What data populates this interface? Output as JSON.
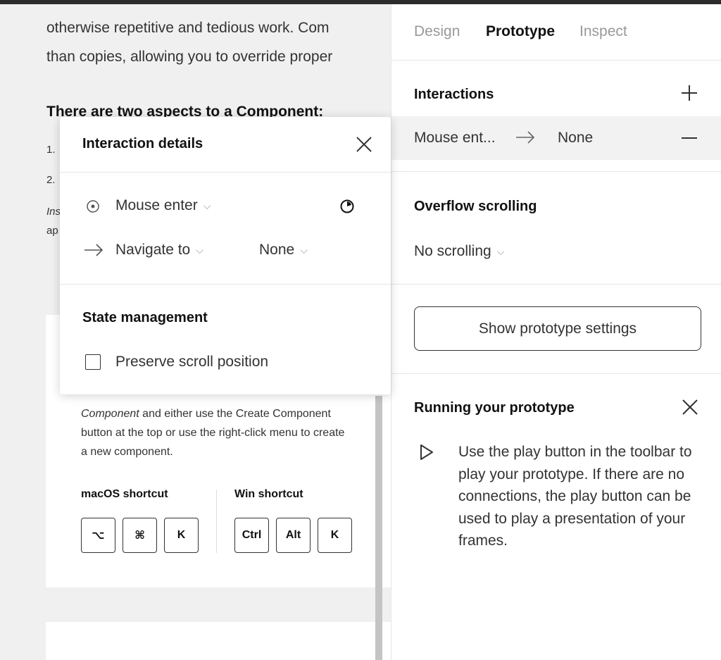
{
  "canvas": {
    "doc_lines": [
      "otherwise repetitive and tedious work. Com",
      "than copies, allowing you to override proper"
    ],
    "heading": "There are two aspects to a Component:",
    "list_items": [
      "1.",
      "2."
    ],
    "italic_lines": [
      "Ins",
      "ap"
    ],
    "card": {
      "lines": [
        "Component and either use the Create Component",
        "button at the top or use the right-click menu to create",
        "a new component."
      ],
      "line1_italic": "Component",
      "line1_rest": " and either use the Create Component",
      "mac_label": "macOS shortcut",
      "win_label": "Win shortcut",
      "mac_keys": [
        "⌥",
        "⌘",
        "K"
      ],
      "win_keys": [
        "Ctrl",
        "Alt",
        "K"
      ]
    }
  },
  "panel": {
    "tabs": [
      {
        "label": "Design",
        "active": false
      },
      {
        "label": "Prototype",
        "active": true
      },
      {
        "label": "Inspect",
        "active": false
      }
    ],
    "interactions": {
      "title": "Interactions",
      "row": {
        "trigger": "Mouse ent...",
        "destination": "None"
      }
    },
    "overflow": {
      "title": "Overflow scrolling",
      "value": "No scrolling"
    },
    "settings_button": "Show prototype settings",
    "running": {
      "title": "Running your prototype",
      "description": "Use the play button in the toolbar to play your prototype. If there are no connections, the play button can be used to play a presentation of your frames."
    }
  },
  "popover": {
    "title": "Interaction details",
    "trigger": "Mouse enter",
    "action": "Navigate to",
    "destination": "None",
    "state_title": "State management",
    "checkbox_label": "Preserve scroll position",
    "checkbox_checked": false
  },
  "icons": [
    "close-icon",
    "plus-icon",
    "minus-icon",
    "arrow-right-icon",
    "chevron-down-icon",
    "trigger-target-icon",
    "timer-icon",
    "play-icon"
  ]
}
